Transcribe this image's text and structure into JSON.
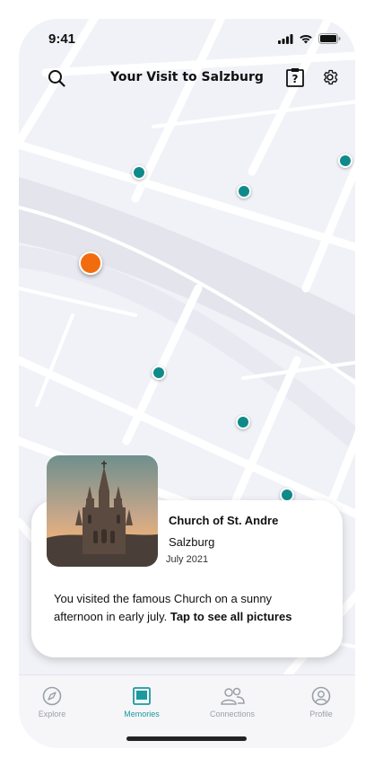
{
  "status_bar": {
    "time": "9:41"
  },
  "header": {
    "title": "Your Visit to Salzburg",
    "search_icon": "search-icon",
    "help_icon": "help-icon",
    "settings_icon": "gear-icon"
  },
  "map": {
    "accent_pin_color": "#0f8a8a",
    "active_pin_color": "#f26c0d"
  },
  "memory_card": {
    "title": "Church of St. Andre",
    "city": "Salzburg",
    "date": "July 2021",
    "description": "You visited the famous Church on a sunny afternoon in early july.",
    "cta": "Tap to see all pictures"
  },
  "tabs": [
    {
      "label": "Explore",
      "icon": "compass-icon"
    },
    {
      "label": "Memories",
      "icon": "memories-icon"
    },
    {
      "label": "Connections",
      "icon": "people-icon"
    },
    {
      "label": "Profile",
      "icon": "profile-icon"
    }
  ],
  "colors": {
    "accent": "#1a9aa0",
    "pin_teal": "#0f8a8a",
    "pin_orange": "#f26c0d"
  }
}
